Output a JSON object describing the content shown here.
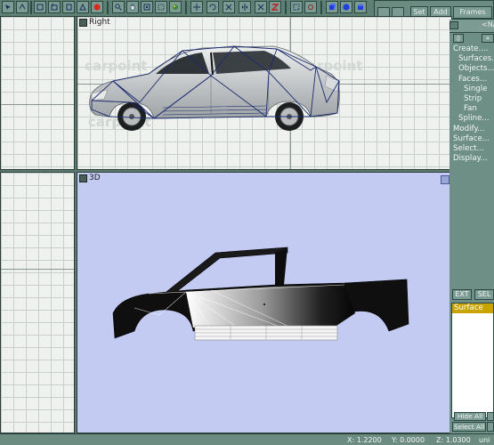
{
  "viewports": {
    "right": {
      "label": "Right"
    },
    "three_d": {
      "label": "3D"
    }
  },
  "top_panel": {
    "set_label": "Set",
    "add_label": "Add",
    "frames_label": "Frames"
  },
  "side_panel": {
    "header_label": "<N/",
    "menu": [
      {
        "label": "Create....",
        "indent": 0
      },
      {
        "label": "Surfaces...",
        "indent": 1
      },
      {
        "label": "Objects...",
        "indent": 1
      },
      {
        "label": "Faces...",
        "indent": 1
      },
      {
        "label": "Single",
        "indent": 2
      },
      {
        "label": "Strip",
        "indent": 2
      },
      {
        "label": "Fan",
        "indent": 2
      },
      {
        "label": "Spline...",
        "indent": 1
      },
      {
        "label": "Modify...",
        "indent": 0
      },
      {
        "label": "Surface...",
        "indent": 0
      },
      {
        "label": "Select...",
        "indent": 0
      },
      {
        "label": "Display...",
        "indent": 0
      }
    ],
    "ext_label": "EXT",
    "sel_label": "SEL",
    "list_selected": "Surface",
    "hide_all_label": "Hide All",
    "select_all_label": "Select All"
  },
  "watermark": "carpoint",
  "status": {
    "x": "X: 1.2200",
    "y": "Y: 0.0000",
    "z": "Z: 1.0300",
    "unit": "uni"
  },
  "colors": {
    "chrome": "#5d7f74",
    "viewport_3d_bg": "#c3cbf3",
    "highlight": "#c9a400"
  }
}
